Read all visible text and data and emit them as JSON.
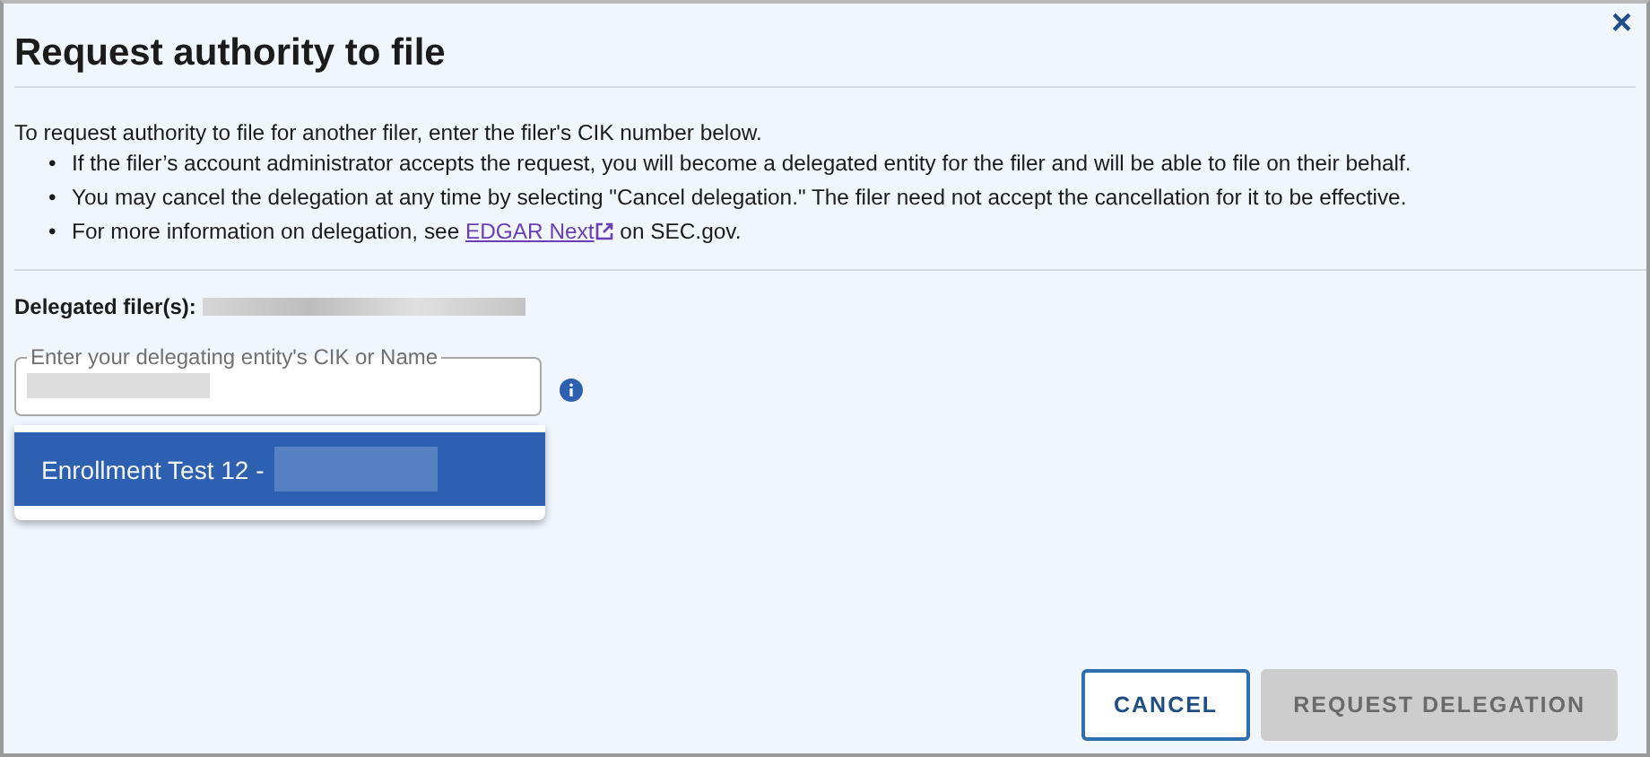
{
  "dialog": {
    "title": "Request authority to file",
    "close": "×"
  },
  "intro": "To request authority to file for another filer, enter the filer's CIK number below.",
  "bullets": [
    {
      "marker": "•",
      "text": "If the filer’s account administrator accepts the request, you will become a delegated entity for the filer and will be able to file on their behalf."
    },
    {
      "marker": "•",
      "text": "You may cancel the delegation at any time by selecting \"Cancel delegation.\" The filer need not accept the cancellation for it to be effective."
    },
    {
      "marker": "•",
      "text": "For more information on delegation, see ",
      "link": "EDGAR Next",
      "after": " on SEC.gov."
    }
  ],
  "delegated_label": "Delegated filer(s):",
  "field": {
    "label": "Enter your delegating entity's CIK or Name"
  },
  "options": [
    {
      "text": "Enrollment Test 12 -",
      "selected": true
    }
  ],
  "buttons": [
    {
      "label": "CANCEL",
      "kind": "outline",
      "disabled": false
    },
    {
      "label": "REQUEST DELEGATION",
      "kind": "primary",
      "disabled": true
    }
  ]
}
